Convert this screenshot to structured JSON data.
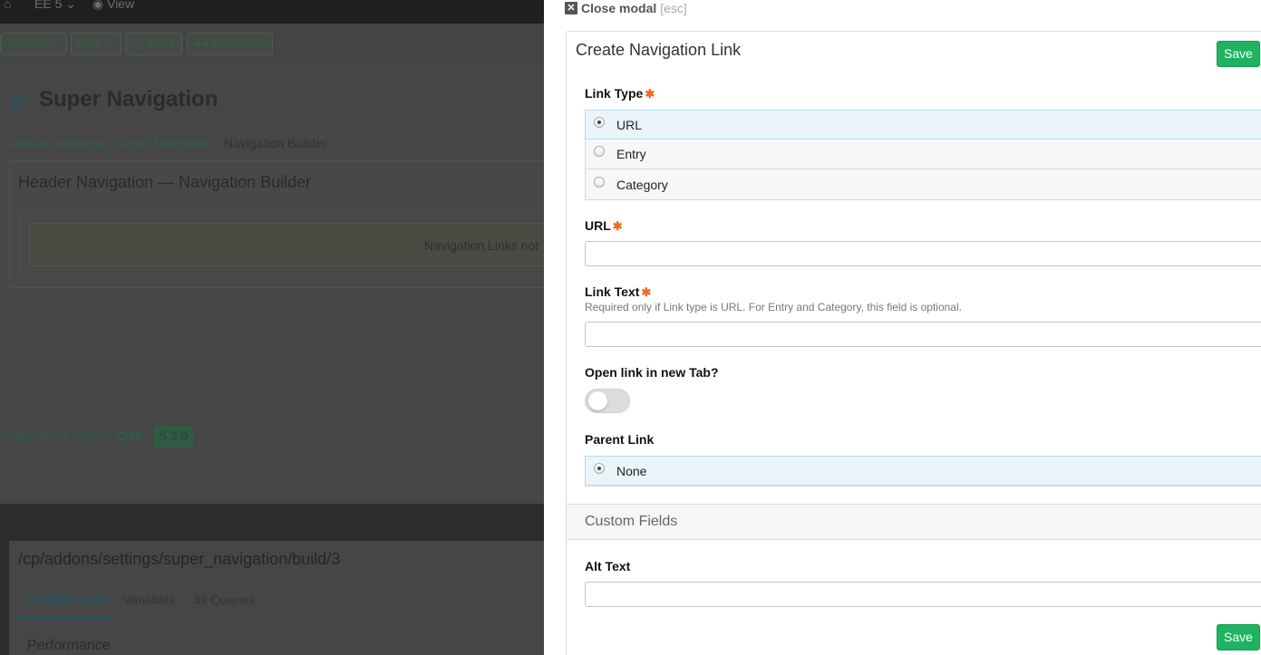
{
  "background": {
    "topbar": {
      "home_icon": "home-icon",
      "site": "EE 5",
      "view": "View"
    },
    "nav": {
      "create": "Create",
      "edit": "Edit",
      "files": "Files",
      "members": "Members"
    },
    "page_title": "Super Navigation",
    "breadcrumb": [
      "Add-On Manager",
      "Super Navigation",
      "Navigation Builder"
    ],
    "panel_title": "Header Navigation — Navigation Builder",
    "alert_text": "Navigation Links not",
    "footer": {
      "brand": "ExpressionEngine®",
      "cms": "CMS",
      "version": "5.3.0"
    },
    "debug": {
      "url": "/cp/addons/settings/super_navigation/build/3",
      "tabs": [
        "0.2128s Load",
        "Variables",
        "39 Queries"
      ],
      "section": "Performance"
    },
    "colors": {
      "accent_green": "#1fb361",
      "required_orange": "#e86d23"
    }
  },
  "modal": {
    "close_label": "Close modal",
    "close_hint": "[esc]",
    "title": "Create Navigation Link",
    "save_label": "Save",
    "link_type": {
      "label": "Link Type",
      "options": [
        "URL",
        "Entry",
        "Category"
      ],
      "selected": "URL"
    },
    "url": {
      "label": "URL",
      "value": ""
    },
    "link_text": {
      "label": "Link Text",
      "description": "Required only if Link type is URL. For Entry and Category, this field is optional.",
      "value": ""
    },
    "new_tab": {
      "label": "Open link in new Tab?",
      "on": false
    },
    "parent_link": {
      "label": "Parent Link",
      "options": [
        "None"
      ],
      "selected": "None"
    },
    "custom_fields": {
      "title": "Custom Fields"
    },
    "alt_text": {
      "label": "Alt Text",
      "value": ""
    }
  }
}
